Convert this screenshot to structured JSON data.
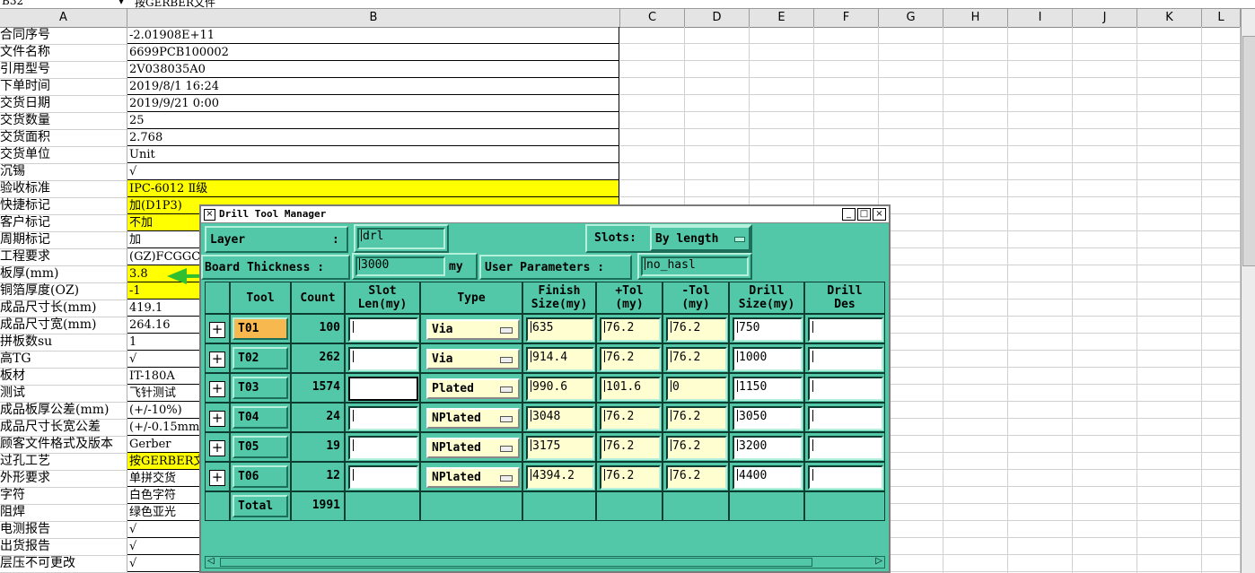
{
  "formula_bar": {
    "cell_ref": "B32",
    "content": "按GERBER文件"
  },
  "columns": [
    "A",
    "B",
    "C",
    "D",
    "E",
    "F",
    "G",
    "H",
    "I",
    "J",
    "K",
    "L"
  ],
  "rows": [
    {
      "a": "合同序号",
      "b": "-2.01908E+11",
      "yellow": false
    },
    {
      "a": "文件名称",
      "b": "6699PCB100002",
      "yellow": false
    },
    {
      "a": "引用型号",
      "b": "2V038035A0",
      "yellow": false
    },
    {
      "a": "下单时间",
      "b": "2019/8/1 16:24",
      "yellow": false
    },
    {
      "a": "交货日期",
      "b": "2019/9/21 0:00",
      "yellow": false
    },
    {
      "a": "交货数量",
      "b": "25",
      "yellow": false
    },
    {
      "a": "交货面积",
      "b": "2.768",
      "yellow": false
    },
    {
      "a": "交货单位",
      "b": "Unit",
      "yellow": false
    },
    {
      "a": "沉锡",
      "b": "√",
      "yellow": false
    },
    {
      "a": "验收标准",
      "b": "IPC-6012 Ⅱ级",
      "yellow": true
    },
    {
      "a": "快捷标记",
      "b": "加(D1P3)",
      "yellow": true
    },
    {
      "a": "客户标记",
      "b": "不加",
      "yellow": true
    },
    {
      "a": "周期标记",
      "b": "加",
      "yellow": false
    },
    {
      "a": "工程要求",
      "b": "(GZ)FCGGC(",
      "yellow": false
    },
    {
      "a": "板厚(mm)",
      "b": "3.8",
      "yellow": true
    },
    {
      "a": "铜箔厚度(OZ)",
      "b": "-1",
      "yellow": true
    },
    {
      "a": "成品尺寸长(mm)",
      "b": "419.1",
      "yellow": false
    },
    {
      "a": "成品尺寸宽(mm)",
      "b": "264.16",
      "yellow": false
    },
    {
      "a": "拼板数su",
      "b": "1",
      "yellow": false
    },
    {
      "a": "高TG",
      "b": "√",
      "yellow": false
    },
    {
      "a": "板材",
      "b": "IT-180A",
      "yellow": false
    },
    {
      "a": "测试",
      "b": "飞针测试",
      "yellow": false
    },
    {
      "a": "成品板厚公差(mm)",
      "b": "(+/-10%)",
      "yellow": false
    },
    {
      "a": "成品尺寸长宽公差",
      "b": "(+/-0.15mm",
      "yellow": false
    },
    {
      "a": "顾客文件格式及版本",
      "b": "Gerber",
      "yellow": false
    },
    {
      "a": "过孔工艺",
      "b": "按GERBER文",
      "yellow": true
    },
    {
      "a": "外形要求",
      "b": "单拼交货",
      "yellow": false
    },
    {
      "a": "字符",
      "b": "白色字符",
      "yellow": false
    },
    {
      "a": "阻焊",
      "b": "绿色亚光",
      "yellow": false
    },
    {
      "a": "电测报告",
      "b": "√",
      "yellow": false
    },
    {
      "a": "出货报告",
      "b": "√",
      "yellow": false
    },
    {
      "a": "层压不可更改",
      "b": "√",
      "yellow": false
    }
  ],
  "dialog": {
    "title": "Drill Tool Manager",
    "layer_label": "Layer",
    "layer_colon": ":",
    "layer_value": "drl",
    "slots_label": "Slots:",
    "slots_value": "By length",
    "thickness_label": "Board Thickness :",
    "thickness_value": "3000",
    "thickness_unit": "my",
    "user_params_label": "User Parameters :",
    "user_params_value": "no_hasl",
    "headers": [
      "Tool",
      "Count",
      "Slot\nLen(my)",
      "Type",
      "Finish\nSize(my)",
      "+Tol\n(my)",
      "-Tol\n(my)",
      "Drill\nSize(my)",
      "Drill\nDes"
    ],
    "tools": [
      {
        "tool": "T01",
        "count": "100",
        "slot_len": "",
        "type": "Via",
        "finish": "635",
        "ptol": "76.2",
        "mtol": "76.2",
        "drill": "750",
        "des": ""
      },
      {
        "tool": "T02",
        "count": "262",
        "slot_len": "",
        "type": "Via",
        "finish": "914.4",
        "ptol": "76.2",
        "mtol": "76.2",
        "drill": "1000",
        "des": ""
      },
      {
        "tool": "T03",
        "count": "1574",
        "slot_len": "",
        "type": "Plated",
        "finish": "990.6",
        "ptol": "101.6",
        "mtol": "0",
        "drill": "1150",
        "des": ""
      },
      {
        "tool": "T04",
        "count": "24",
        "slot_len": "",
        "type": "NPlated",
        "finish": "3048",
        "ptol": "76.2",
        "mtol": "76.2",
        "drill": "3050",
        "des": ""
      },
      {
        "tool": "T05",
        "count": "19",
        "slot_len": "",
        "type": "NPlated",
        "finish": "3175",
        "ptol": "76.2",
        "mtol": "76.2",
        "drill": "3200",
        "des": ""
      },
      {
        "tool": "T06",
        "count": "12",
        "slot_len": "",
        "type": "NPlated",
        "finish": "4394.2",
        "ptol": "76.2",
        "mtol": "76.2",
        "drill": "4400",
        "des": ""
      }
    ],
    "total_label": "Total",
    "total_count": "1991"
  },
  "colors": {
    "dialog_bg": "#52c8a8",
    "highlight_yellow": "#ffff00",
    "active_tool": "#f8b850",
    "arrow_green": "#2fbf2f"
  }
}
